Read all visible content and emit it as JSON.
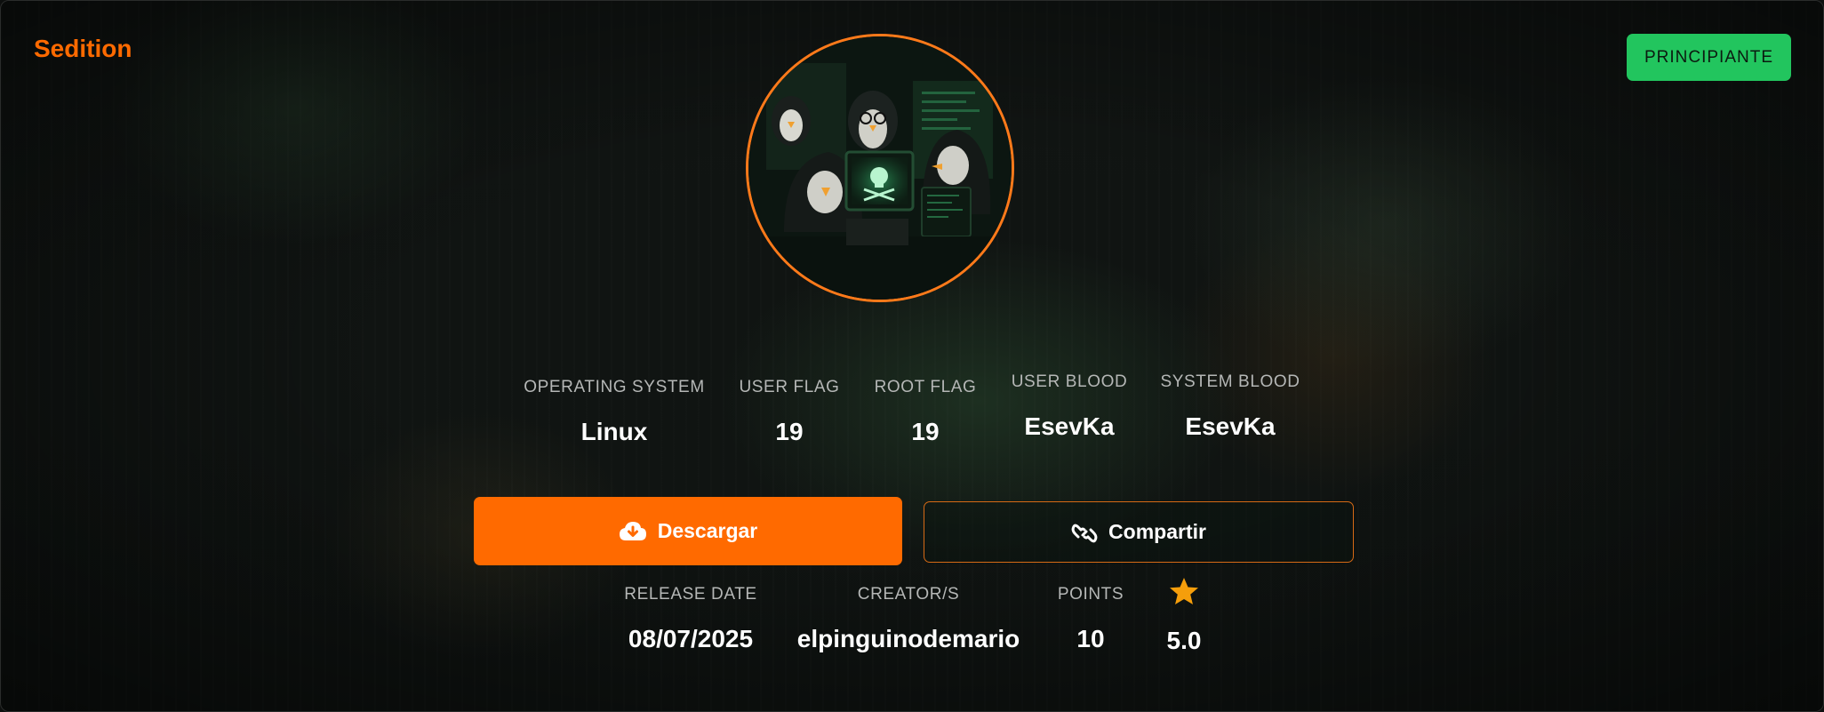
{
  "machine": {
    "name": "Sedition",
    "difficulty": "PRINCIPIANTE"
  },
  "avatar": {
    "icon": "hacker-penguins-image"
  },
  "stats": [
    {
      "label": "OPERATING SYSTEM",
      "value": "Linux"
    },
    {
      "label": "USER FLAG",
      "value": "19"
    },
    {
      "label": "ROOT FLAG",
      "value": "19"
    },
    {
      "label": "USER BLOOD",
      "value": "EsevKa"
    },
    {
      "label": "SYSTEM BLOOD",
      "value": "EsevKa"
    }
  ],
  "actions": {
    "download_label": "Descargar",
    "share_label": "Compartir"
  },
  "details": [
    {
      "label": "RELEASE DATE",
      "value": "08/07/2025"
    },
    {
      "label": "CREATOR/S",
      "value": "elpinguinodemario"
    },
    {
      "label": "POINTS",
      "value": "10"
    },
    {
      "label": "",
      "value": "5.0",
      "icon": "star-icon"
    }
  ],
  "colors": {
    "accent": "#ff6a00",
    "badge": "#22c55e",
    "star": "#f59e0b"
  }
}
